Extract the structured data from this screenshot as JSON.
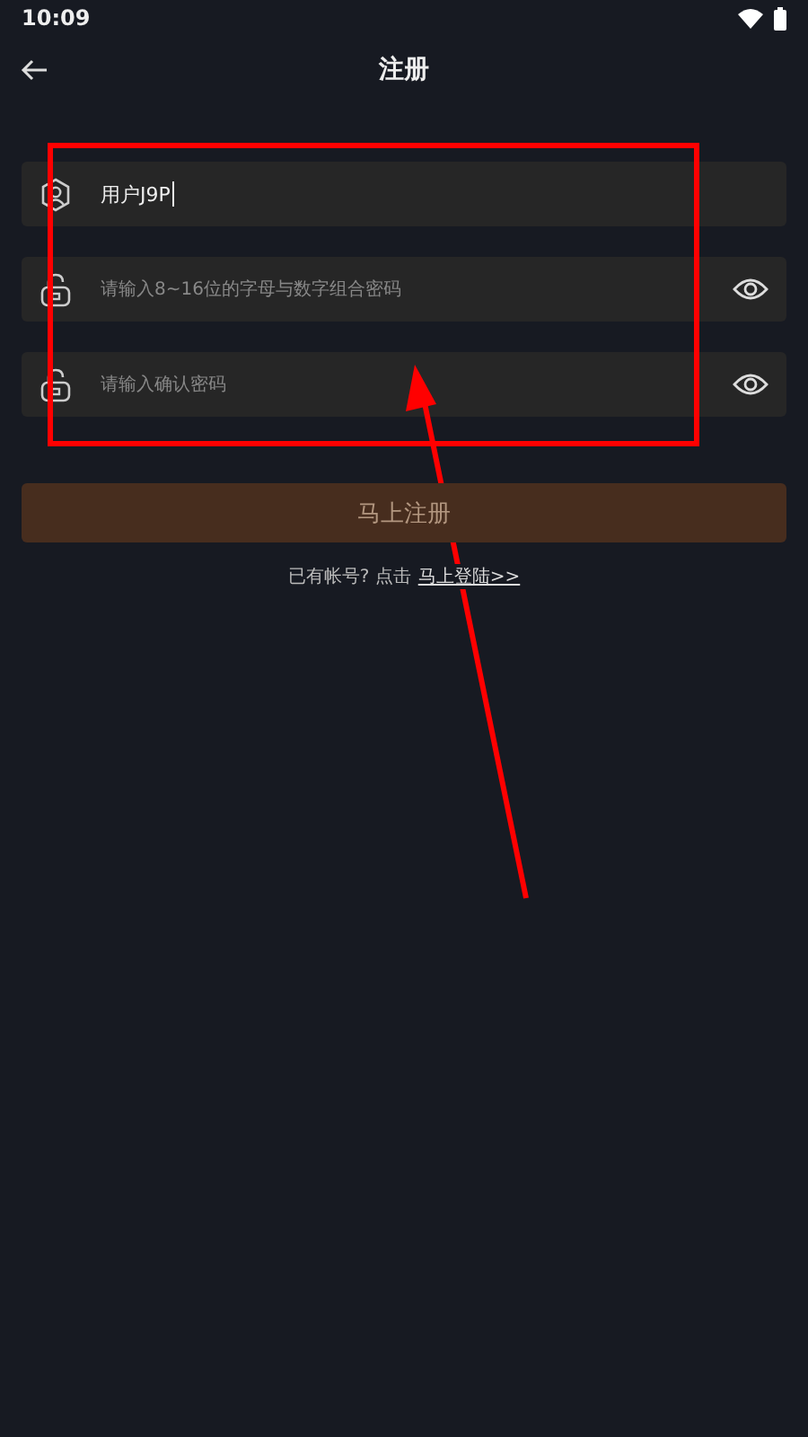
{
  "status_bar": {
    "time": "10:09"
  },
  "header": {
    "title": "注册"
  },
  "fields": [
    {
      "kind": "user",
      "value": "用户J9P",
      "reveal": false
    },
    {
      "kind": "lock",
      "placeholder": "请输入8~16位的字母与数字组合密码",
      "reveal": true
    },
    {
      "kind": "lock",
      "placeholder": "请输入确认密码",
      "reveal": true
    }
  ],
  "submit": {
    "label": "马上注册",
    "disabled": true
  },
  "login_prompt": {
    "text": "已有帐号? 点击",
    "link": "马上登陆>>"
  },
  "annotation": {
    "kind": "box-arrow"
  }
}
